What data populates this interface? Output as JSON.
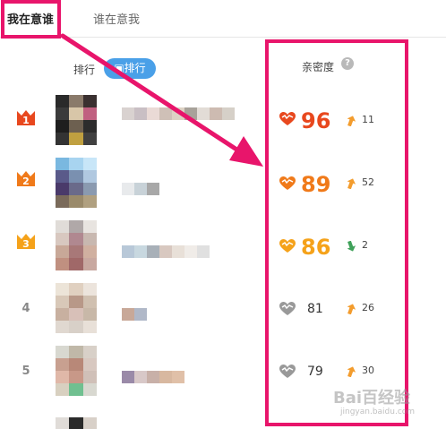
{
  "tabs": {
    "active": "我在意谁",
    "inactive": "谁在意我"
  },
  "sort": {
    "label": "排行",
    "pill": "▣排行"
  },
  "intimacy": {
    "label": "亲密度",
    "help": "?"
  },
  "rows": [
    {
      "rank": "1",
      "score": "96",
      "delta": "11",
      "trend": "up",
      "color": "#e8481e"
    },
    {
      "rank": "2",
      "score": "89",
      "delta": "52",
      "trend": "up",
      "color": "#f07a1a"
    },
    {
      "rank": "3",
      "score": "86",
      "delta": "2",
      "trend": "down",
      "color": "#f5a21a"
    },
    {
      "rank": "4",
      "score": "81",
      "delta": "26",
      "trend": "up",
      "color": "#999999"
    },
    {
      "rank": "5",
      "score": "79",
      "delta": "30",
      "trend": "up",
      "color": "#999999"
    }
  ],
  "watermark": {
    "text": "Bai百经验",
    "sub": "jingyan.baidu.com"
  },
  "colors": {
    "highlight": "#e8156b",
    "pill": "#4aa0e8",
    "up_arrow": "#f39c2d",
    "down_arrow": "#3fa15a"
  }
}
